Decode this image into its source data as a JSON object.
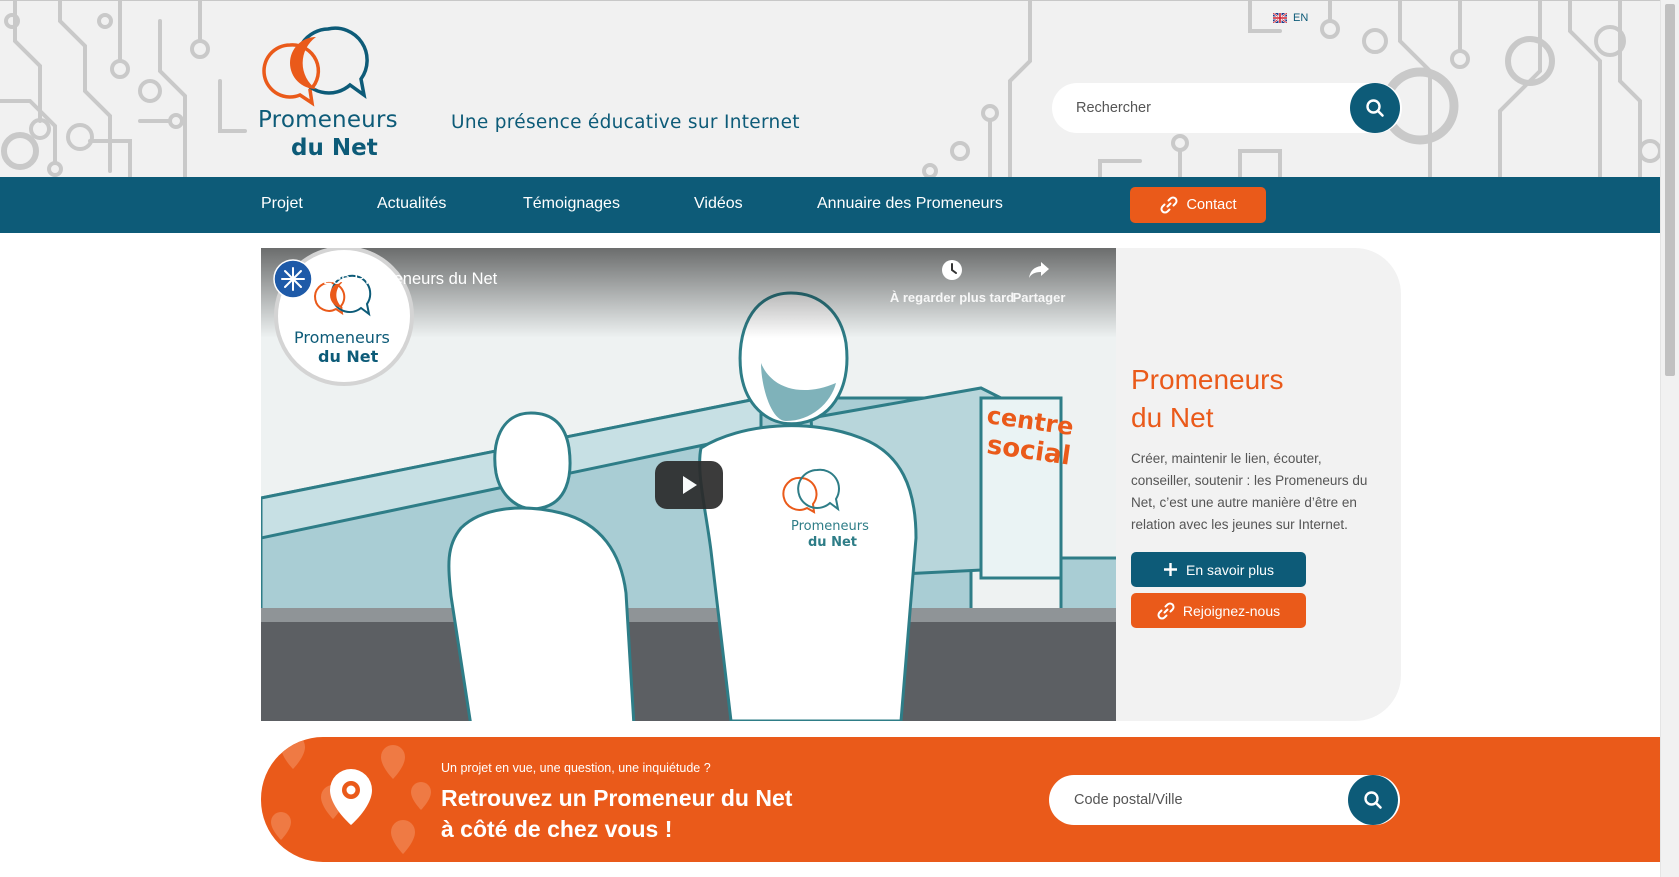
{
  "header": {
    "logo_line1": "Promeneurs",
    "logo_line2": "du Net",
    "tagline": "Une présence éducative sur Internet",
    "language": "EN",
    "search_placeholder": "Rechercher"
  },
  "nav": {
    "items": [
      "Projet",
      "Actualités",
      "Témoignages",
      "Vidéos",
      "Annuaire des Promeneurs"
    ],
    "contact_label": "Contact"
  },
  "video": {
    "title": "Les Promeneurs du Net",
    "watch_later": "À regarder plus tard",
    "share": "Partager",
    "badge_line1": "Promeneurs",
    "badge_line2": "du Net",
    "sign_line1": "centre",
    "sign_line2": "social",
    "shirt_line1": "Promeneurs",
    "shirt_line2": "du Net"
  },
  "side": {
    "title_line1": "Promeneurs",
    "title_line2": "du Net",
    "text": "Créer, maintenir le lien, écouter, conseiller, soutenir : les Promeneurs du Net, c’est une autre manière d’être en relation avec les jeunes sur Internet.",
    "more_label": "En savoir plus",
    "join_label": "Rejoignez-nous"
  },
  "finder": {
    "subtitle": "Un projet en vue, une question, une inquiétude ?",
    "title_line1": "Retrouvez un Promeneur du Net",
    "title_line2": "à côté de chez vous !",
    "placeholder": "Code postal/Ville"
  },
  "colors": {
    "primary": "#0d5b78",
    "accent": "#ea5a1a",
    "header_bg": "#f1f1f1"
  },
  "icons": [
    "uk-flag-icon",
    "search-icon",
    "link-icon",
    "clock-icon",
    "share-arrow-icon",
    "play-icon",
    "plus-icon",
    "map-pin-icon"
  ]
}
